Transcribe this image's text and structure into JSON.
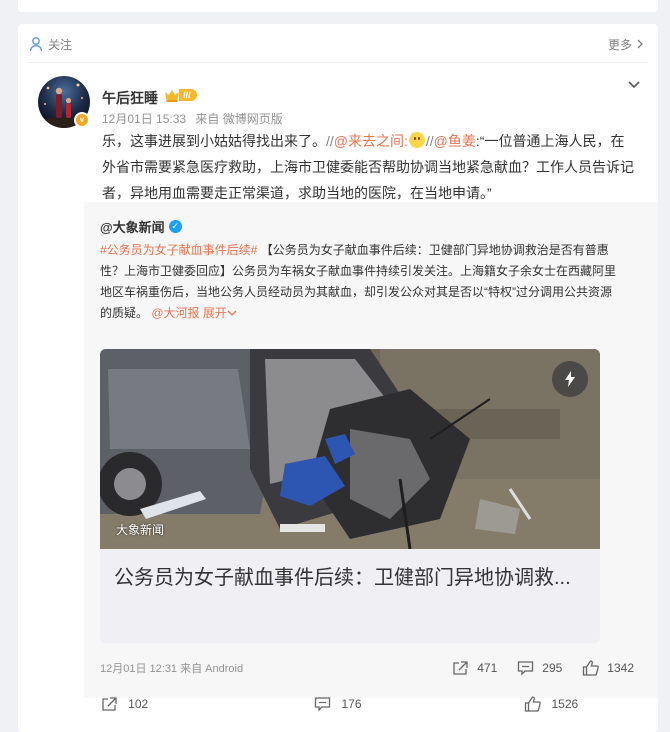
{
  "post": {
    "follow_label": "关注",
    "more_label": "更多",
    "username": "午后狂睡",
    "vip_level": "III",
    "avatar_badge": "v",
    "timestamp": "12月01日 15:33",
    "source": "来自 微博网页版",
    "text_parts": {
      "p1": "乐，这事进展到小姑姑得找出来了。",
      "sep1": "//",
      "m1": "@来去之间:",
      "sep2": "//",
      "m2": "@鱼姜",
      "p2": ":“一位普通上海人民，在外省市需要紧急医疗救助，上海市卫健委能否帮助协调当地紧急献血？工作人员告诉记者，异地用血需要走正常渠道，求助当地的医院，在当地申请。”"
    },
    "actions": {
      "repost": "102",
      "comment": "176",
      "like": "1526"
    }
  },
  "repost": {
    "username": "@大象新闻",
    "topic": "#公务员为女子献血事件后续#",
    "body": "【公务员为女子献血事件后续：卫健部门异地协调救治是否有普惠性？上海市卫健委回应】公务员为车祸女子献血事件持续引发关注。上海籍女子余女士在西藏阿里地区车祸重伤后，当地公务人员经动员为其献血，却引发公众对其是否以“特权”过分调用公共资源的质疑。",
    "mention": "@大河报",
    "expand": "展开",
    "media": {
      "watermark": "大象新闻",
      "title": "公务员为女子献血事件后续：卫健部门异地协调救..."
    },
    "timestamp": "12月01日 12:31",
    "source": "来自 Android",
    "actions": {
      "repost": "471",
      "comment": "295",
      "like": "1342"
    }
  },
  "icons": [
    "user-icon",
    "chevron-right-icon",
    "chevron-down-icon",
    "crown-icon",
    "verified-icon",
    "flash-icon",
    "repost-icon",
    "comment-icon",
    "like-icon"
  ],
  "colors": {
    "accent": "#eb7350",
    "meta": "#939393",
    "vip": "#f5b82c",
    "verified": "#1da1f2"
  }
}
